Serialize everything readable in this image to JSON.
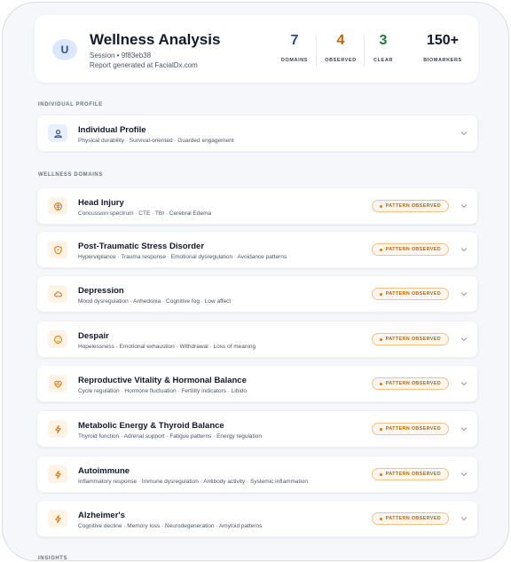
{
  "header": {
    "avatar_letter": "U",
    "title": "Wellness Analysis",
    "session": "Session • 9f83eb38",
    "report": "Report generated at FacialDx.com",
    "stats": [
      {
        "value": "7",
        "label": "DOMAINS",
        "color": "#2b4a8f"
      },
      {
        "value": "4",
        "label": "OBSERVED",
        "color": "#c2650a"
      },
      {
        "value": "3",
        "label": "CLEAR",
        "color": "#1f7a3a"
      },
      {
        "value": "150+",
        "label": "BIOMARKERS",
        "color": "#111827"
      }
    ]
  },
  "sections": {
    "profile_label": "INDIVIDUAL PROFILE",
    "domains_label": "WELLNESS DOMAINS",
    "insights_label": "INSIGHTS"
  },
  "profile": {
    "title": "Individual Profile",
    "desc": "Physical durability · Survival-oriented · Guarded engagement",
    "icon": "person-icon"
  },
  "badge_label": "PATTERN OBSERVED",
  "domains": [
    {
      "title": "Head Injury",
      "desc": "Concussion spectrum · CTE · TBI · Cerebral Edema",
      "icon": "brain-icon"
    },
    {
      "title": "Post-Traumatic Stress Disorder",
      "desc": "Hypervigilance · Trauma response · Emotional dysregulation · Avoidance patterns",
      "icon": "shield-icon"
    },
    {
      "title": "Depression",
      "desc": "Mood dysregulation · Anhedonia · Cognitive fog · Low affect",
      "icon": "cloud-icon"
    },
    {
      "title": "Despair",
      "desc": "Hopelessness · Emotional exhaustion · Withdrawal · Loss of meaning",
      "icon": "sad-face-icon"
    },
    {
      "title": "Reproductive Vitality & Hormonal Balance",
      "desc": "Cycle regulation · Hormone fluctuation · Fertility indicators · Libido",
      "icon": "heart-pulse-icon"
    },
    {
      "title": "Metabolic Energy & Thyroid Balance",
      "desc": "Thyroid function · Adrenal support · Fatigue patterns · Energy regulation",
      "icon": "lightning-icon"
    },
    {
      "title": "Autoimmune",
      "desc": "Inflammatory response · Immune dysregulation · Antibody activity · Systemic inflammation",
      "icon": "lightning-icon"
    },
    {
      "title": "Alzheimer's",
      "desc": "Cognitive decline · Memory loss · Neurodegeneration · Amyloid patterns",
      "icon": "lightning-icon"
    }
  ]
}
